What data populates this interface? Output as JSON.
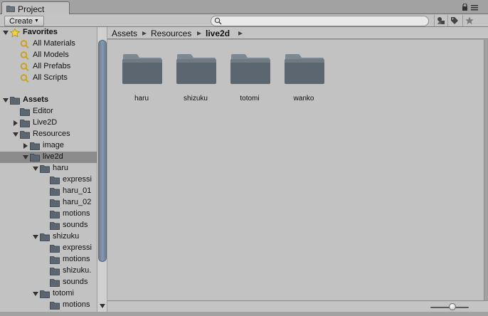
{
  "window": {
    "tab_title": "Project"
  },
  "toolbar": {
    "create_label": "Create",
    "search_value": "",
    "search_placeholder": ""
  },
  "tree": {
    "favorites": {
      "label": "Favorites",
      "items": [
        "All Materials",
        "All Models",
        "All Prefabs",
        "All Scripts"
      ]
    },
    "assets": {
      "label": "Assets",
      "editor": "Editor",
      "live2d_folder": "Live2D",
      "resources": "Resources",
      "image": "image",
      "live2d": "live2d",
      "haru": "haru",
      "haru_children": [
        "expressi",
        "haru_01",
        "haru_02",
        "motions",
        "sounds"
      ],
      "shizuku": "shizuku",
      "shizuku_children": [
        "expressi",
        "motions",
        "shizuku.",
        "sounds"
      ],
      "totomi": "totomi",
      "totomi_children": [
        "motions"
      ]
    }
  },
  "breadcrumb": [
    "Assets",
    "Resources",
    "live2d"
  ],
  "folders": [
    "haru",
    "shizuku",
    "totomi",
    "wanko"
  ],
  "colors": {
    "folder_body": "#5b6670",
    "selection": "#8c8c8c",
    "scrollbar_thumb": "#7d8ea3",
    "star": "#f3d23b"
  }
}
